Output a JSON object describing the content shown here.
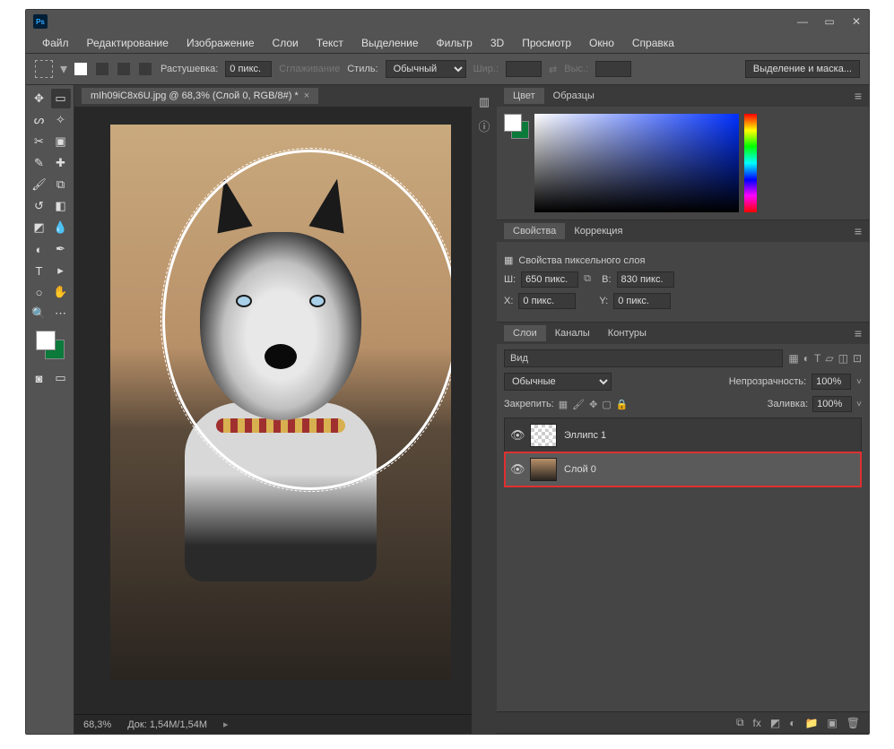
{
  "titlebar": {
    "app_icon": "Ps"
  },
  "menubar": [
    "Файл",
    "Редактирование",
    "Изображение",
    "Слои",
    "Текст",
    "Выделение",
    "Фильтр",
    "3D",
    "Просмотр",
    "Окно",
    "Справка"
  ],
  "optbar": {
    "feather_label": "Растушевка:",
    "feather_value": "0 пикс.",
    "antialias": "Сглаживание",
    "style_label": "Стиль:",
    "style_value": "Обычный",
    "width_label": "Шир.:",
    "height_label": "Выс.:",
    "select_mask": "Выделение и маска..."
  },
  "document": {
    "tab_title": "mIh09iC8x6U.jpg @ 68,3% (Слой 0, RGB/8#) *"
  },
  "statusbar": {
    "zoom": "68,3%",
    "docsize": "Док: 1,54M/1,54M"
  },
  "panels": {
    "color": {
      "tab1": "Цвет",
      "tab2": "Образцы"
    },
    "properties": {
      "tab1": "Свойства",
      "tab2": "Коррекция",
      "title": "Свойства пиксельного слоя",
      "w_label": "Ш:",
      "w_value": "650 пикс.",
      "h_label": "В:",
      "h_value": "830 пикс.",
      "x_label": "X:",
      "x_value": "0 пикс.",
      "y_label": "Y:",
      "y_value": "0 пикс."
    },
    "layers": {
      "tab1": "Слои",
      "tab2": "Каналы",
      "tab3": "Контуры",
      "search_prefix": "🔍",
      "search_value": "Вид",
      "blend_mode": "Обычные",
      "opacity_label": "Непрозрачность:",
      "opacity_value": "100%",
      "lock_label": "Закрепить:",
      "fill_label": "Заливка:",
      "fill_value": "100%",
      "items": [
        {
          "name": "Эллипс 1",
          "selected": false,
          "type": "ellipse"
        },
        {
          "name": "Слой 0",
          "selected": true,
          "type": "image"
        }
      ]
    }
  }
}
